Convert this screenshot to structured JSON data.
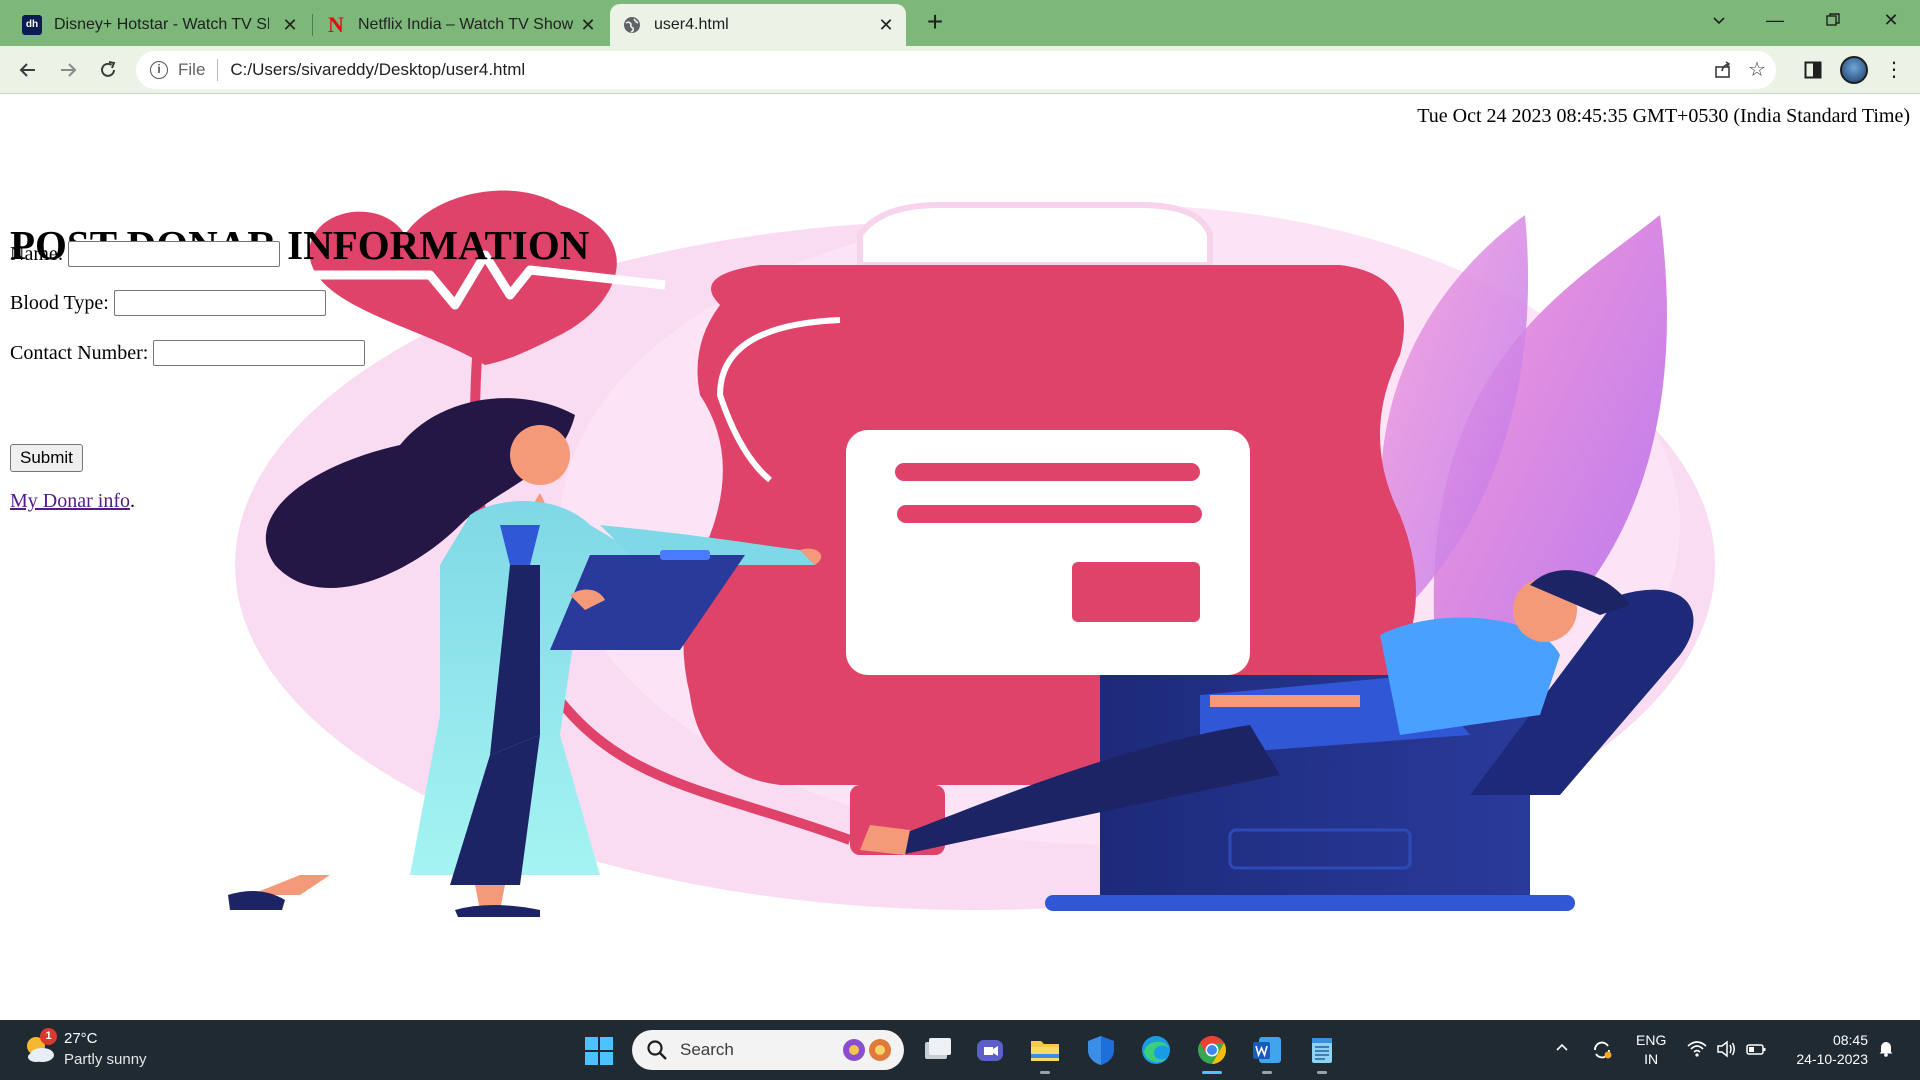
{
  "browser": {
    "tabs": [
      {
        "title": "Disney+ Hotstar - Watch TV Shows",
        "favicon": "hotstar-icon",
        "favicon_text": "dh"
      },
      {
        "title": "Netflix India – Watch TV Shows Online",
        "favicon": "netflix-icon",
        "favicon_text": "N"
      },
      {
        "title": "user4.html",
        "favicon": "globe-icon",
        "active": true
      }
    ],
    "address": {
      "scheme_label": "File",
      "url": "C:/Users/sivareddy/Desktop/user4.html"
    }
  },
  "page": {
    "datetime": "Tue Oct 24 2023 08:45:35 GMT+0530 (India Standard Time)",
    "heading": "POST DONAR INFORMATION",
    "fields": [
      {
        "label": "Name:",
        "value": ""
      },
      {
        "label": "Blood Type:",
        "value": ""
      },
      {
        "label": "Contact Number:",
        "value": ""
      }
    ],
    "submit_label": "Submit",
    "link_text": "My Donar info",
    "link_suffix": "."
  },
  "taskbar": {
    "weather": {
      "temp": "27°C",
      "desc": "Partly sunny",
      "badge": "1"
    },
    "search_placeholder": "Search",
    "apps": [
      "task-view-icon",
      "teams-icon",
      "file-explorer-icon",
      "defender-icon",
      "edge-icon",
      "chrome-icon",
      "word-icon",
      "notepad-icon"
    ],
    "language": {
      "line1": "ENG",
      "line2": "IN"
    },
    "clock": {
      "time": "08:45",
      "date": "24-10-2023"
    }
  },
  "colors": {
    "tab_strip": "#7db87a",
    "toolbar": "#eaf3e6",
    "link_visited": "#551a8b",
    "taskbar": "#202a33",
    "accent": "#4cc2ff"
  }
}
